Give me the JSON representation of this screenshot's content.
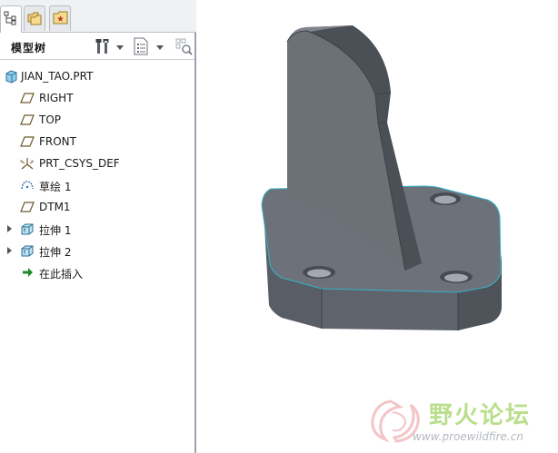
{
  "tree_panel": {
    "title": "模型树",
    "items": [
      {
        "label": "JIAN_TAO.PRT",
        "icon": "part-icon",
        "expandable": false
      },
      {
        "label": "RIGHT",
        "icon": "datum-plane-icon",
        "expandable": false
      },
      {
        "label": "TOP",
        "icon": "datum-plane-icon",
        "expandable": false
      },
      {
        "label": "FRONT",
        "icon": "datum-plane-icon",
        "expandable": false
      },
      {
        "label": "PRT_CSYS_DEF",
        "icon": "coordinate-system-icon",
        "expandable": false
      },
      {
        "label": "草绘 1",
        "icon": "sketch-icon",
        "expandable": false
      },
      {
        "label": "DTM1",
        "icon": "datum-plane-icon",
        "expandable": false
      },
      {
        "label": "拉伸 1",
        "icon": "extrude-icon",
        "expandable": true
      },
      {
        "label": "拉伸 2",
        "icon": "extrude-icon",
        "expandable": true
      },
      {
        "label": "在此插入",
        "icon": "insert-here-arrow-icon",
        "expandable": false
      }
    ]
  },
  "tabs": [
    {
      "name": "model-tree-tab",
      "icon": "tree-icon",
      "active": true
    },
    {
      "name": "folder-browser-tab",
      "icon": "folder-icon",
      "active": false
    },
    {
      "name": "favorites-tab",
      "icon": "favorites-icon",
      "active": false
    }
  ],
  "toolbar": {
    "settings_icon": "tools-icon",
    "show_icon": "show-list-icon",
    "filter_icon": "filter-icon"
  },
  "watermark": {
    "title": "野火论坛",
    "url": "www.proewildfire.cn"
  },
  "colors": {
    "model_dark": "#565b63",
    "model_mid": "#6f747c",
    "model_light": "#858a91",
    "edge_highlight": "#33b3c9",
    "insert_arrow": "#1d8a2a",
    "watermark_green": "#b9df8c"
  }
}
